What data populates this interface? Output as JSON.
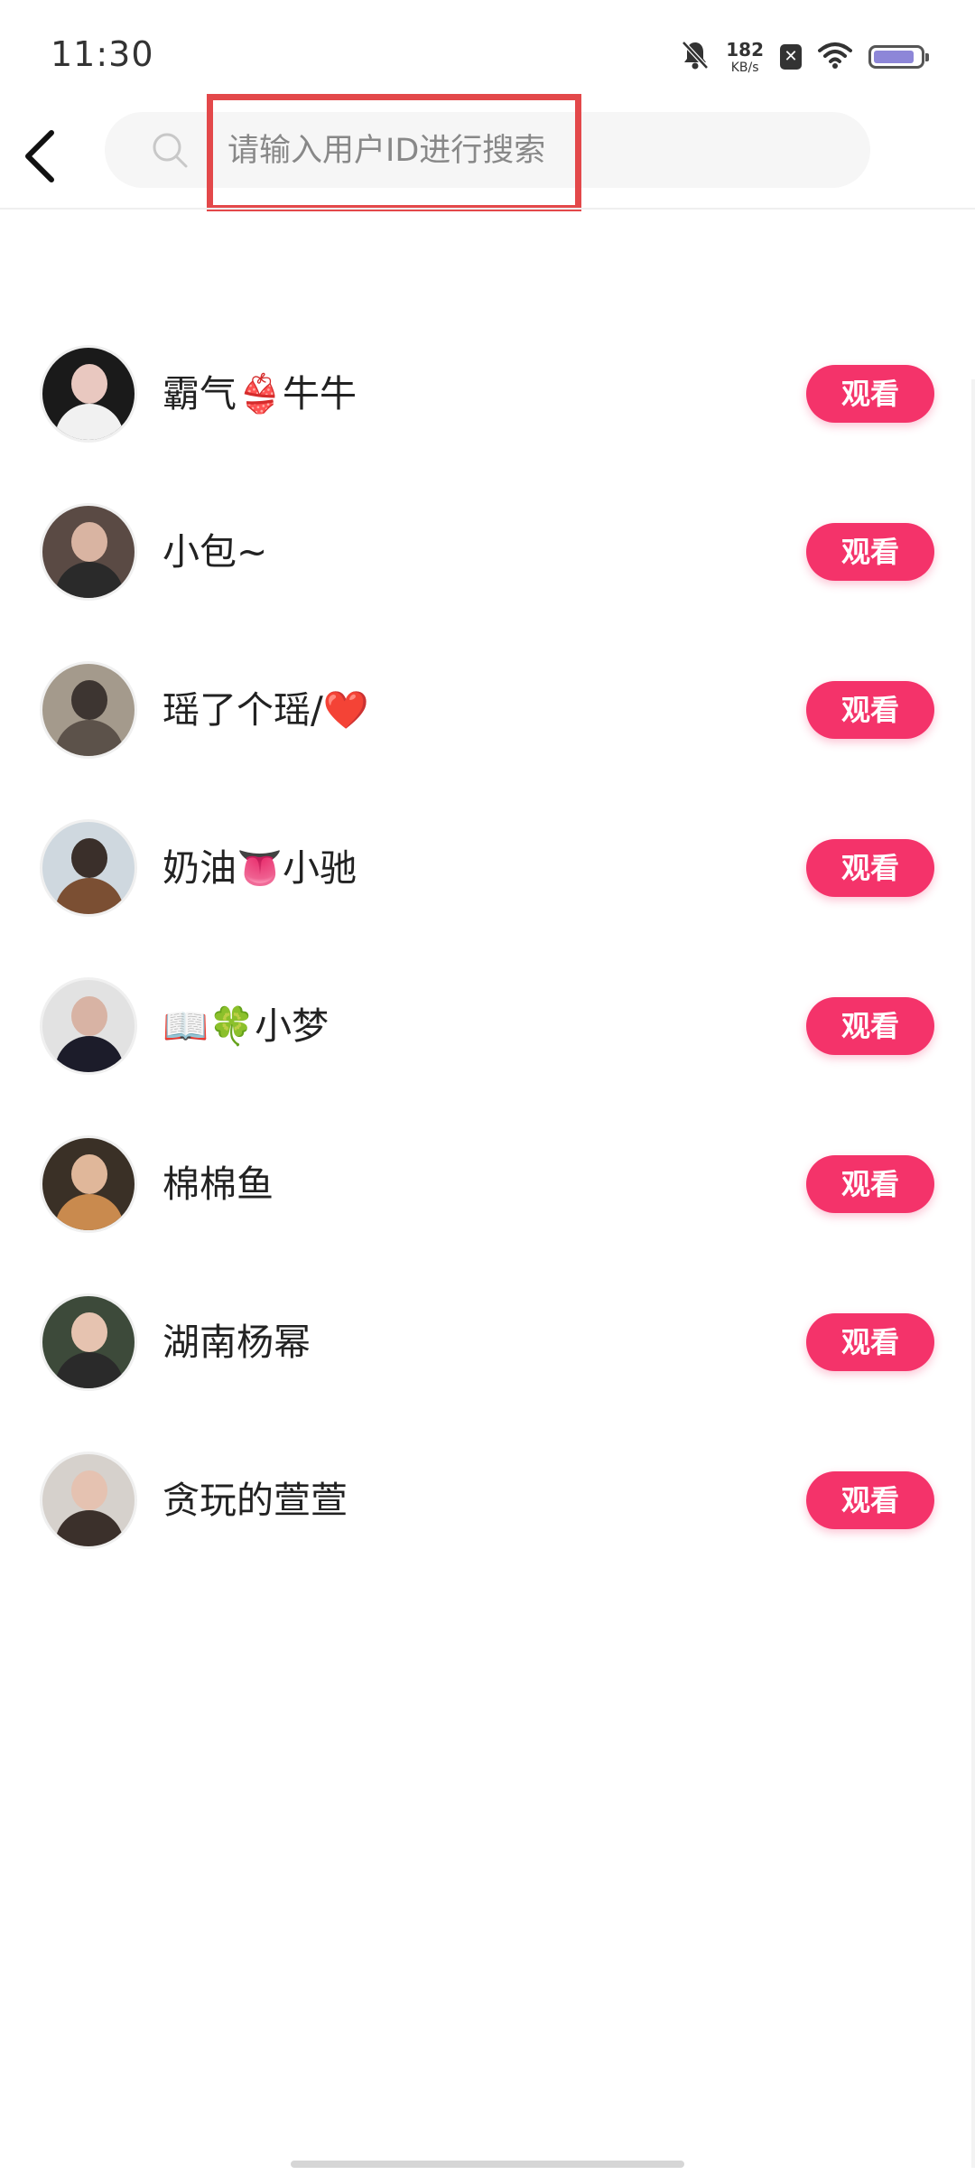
{
  "status_bar": {
    "time": "11:30",
    "net_speed_value": "182",
    "net_speed_unit": "KB/s",
    "icons": [
      "bell-muted-icon",
      "sim-x-icon",
      "wifi-icon",
      "battery-icon"
    ]
  },
  "search": {
    "placeholder": "请输入用户ID进行搜索",
    "value": ""
  },
  "users": [
    {
      "name": "霸气👙牛牛",
      "action": "观看"
    },
    {
      "name": "小包~",
      "action": "观看"
    },
    {
      "name": "瑶了个瑶/❤️",
      "action": "观看"
    },
    {
      "name": " 奶油👅小驰",
      "action": "观看"
    },
    {
      "name": "📖🍀小梦",
      "action": "观看"
    },
    {
      "name": "棉棉鱼",
      "action": "观看"
    },
    {
      "name": "湖南杨幂",
      "action": "观看"
    },
    {
      "name": "贪玩的萱萱",
      "action": "观看"
    }
  ],
  "colors": {
    "accent": "#f4336a",
    "highlight": "#e3484a",
    "search_bg": "#f6f6f6"
  }
}
